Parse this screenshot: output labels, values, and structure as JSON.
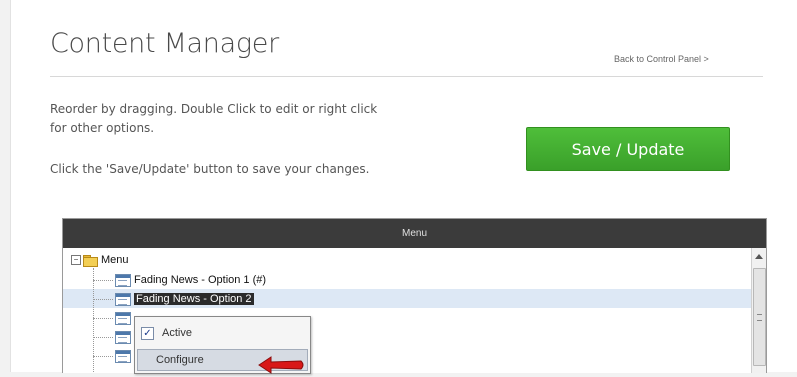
{
  "header": {
    "title": "Content Manager",
    "back_link": "Back to Control Panel >"
  },
  "instructions": {
    "line1": "Reorder by dragging. Double Click to edit or right click",
    "line2": "for other options.",
    "line3": "Click the 'Save/Update' button to save your changes."
  },
  "save_button": {
    "label": "Save / Update"
  },
  "tree": {
    "header": "Menu",
    "root": {
      "label": "Menu"
    },
    "items": [
      {
        "label": "Fading News - Option 1 (#)"
      },
      {
        "label": "Fading News - Option 2"
      }
    ]
  },
  "context_menu": {
    "active_label": "Active",
    "active_checked": true,
    "configure_label": "Configure"
  },
  "colors": {
    "save_green": "#3aa02a",
    "tree_header": "#3b3b3b",
    "selection": "#dde8f5",
    "arrow_red": "#d81818"
  }
}
